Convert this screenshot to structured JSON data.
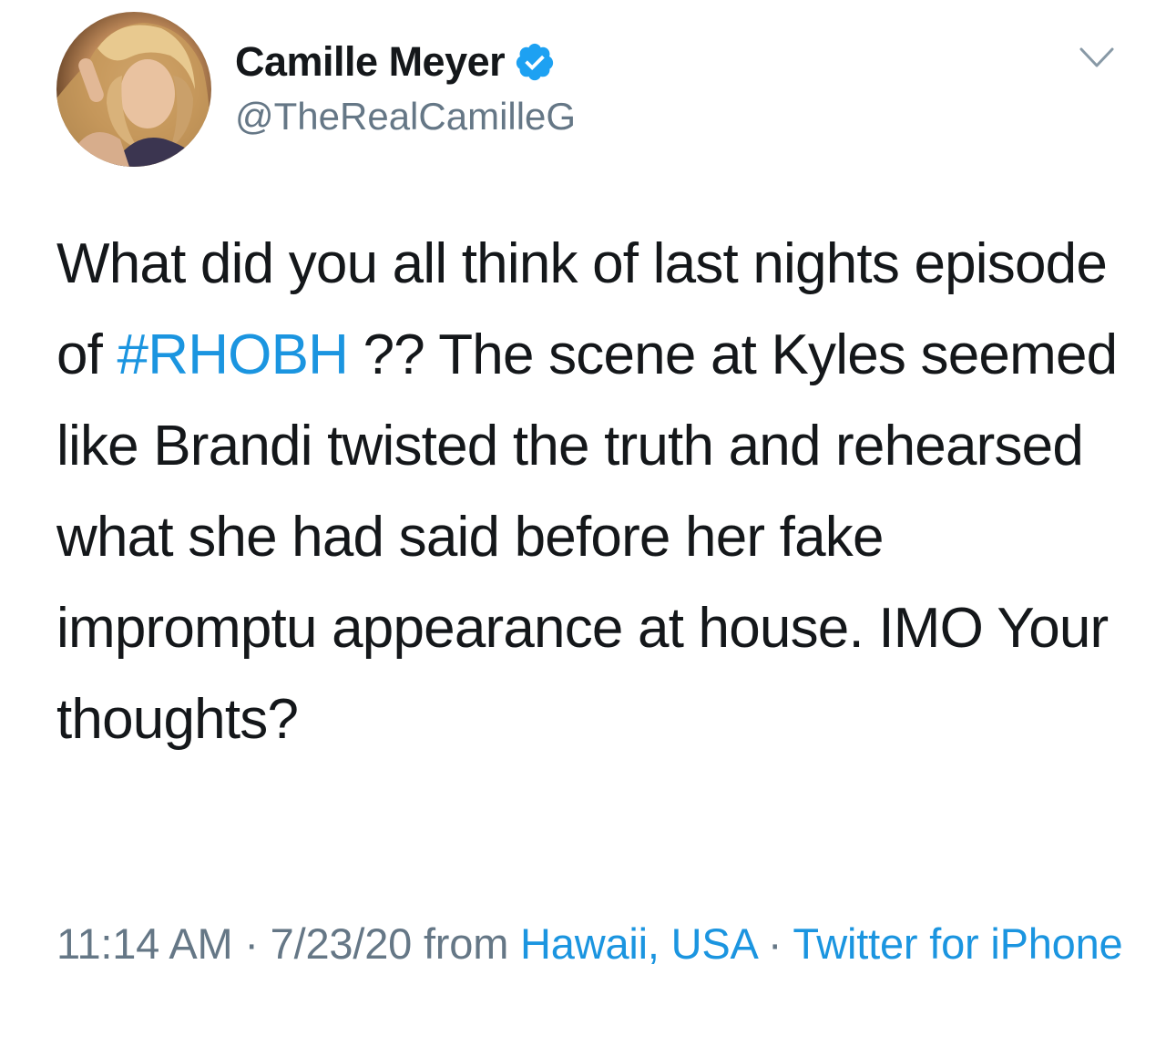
{
  "author": {
    "display_name": "Camille Meyer",
    "handle": "@TheRealCamilleG",
    "verified": true
  },
  "tweet": {
    "text_before_hashtag": "What did you all think of last nights episode of ",
    "hashtag": "#RHOBH",
    "text_after_hashtag": " ?? The scene at Kyles seemed like Brandi twisted the truth and rehearsed what she had said before her fake impromptu appearance at  house. IMO  Your thoughts?"
  },
  "meta": {
    "time": "11:14 AM",
    "separator": " · ",
    "date": "7/23/20",
    "from_label": " from ",
    "location": "Hawaii, USA",
    "source": "Twitter for iPhone"
  },
  "colors": {
    "link": "#1b95e0",
    "secondary_text": "#657786",
    "primary_text": "#14171a",
    "verified_badge": "#1da1f2"
  },
  "icons": {
    "verified": "verified-badge-icon",
    "more": "chevron-down-icon"
  }
}
